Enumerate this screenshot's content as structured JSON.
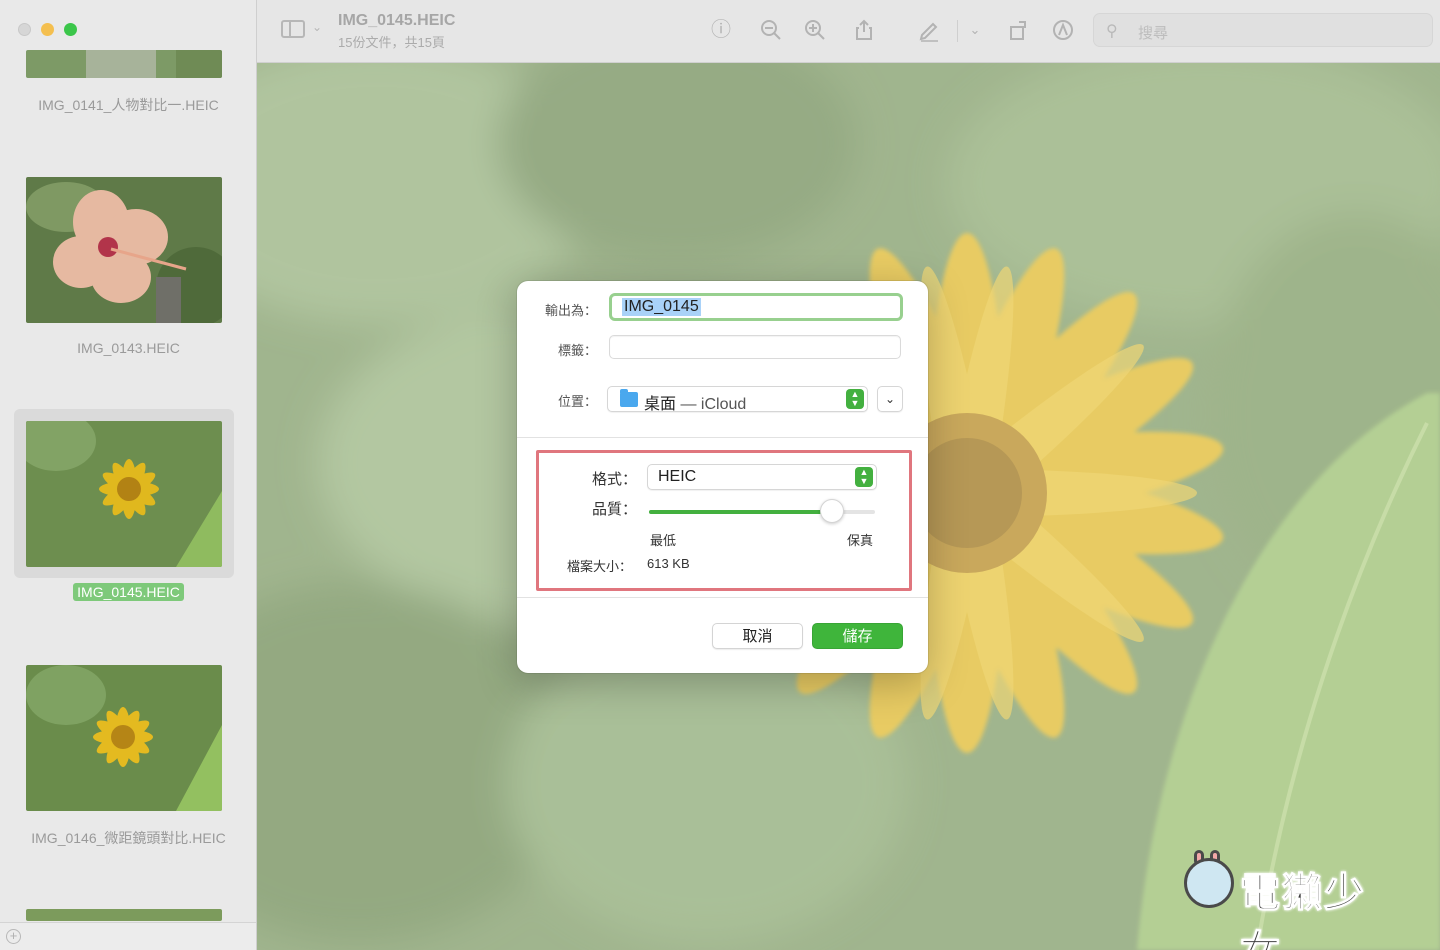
{
  "window": {
    "doc_title": "IMG_0145.HEIC",
    "doc_subtitle": "15份文件，共15頁",
    "search_placeholder": "搜尋"
  },
  "sidebar": {
    "items": [
      {
        "label": "IMG_0141_人物對比一.HEIC"
      },
      {
        "label": "IMG_0143.HEIC"
      },
      {
        "label": "IMG_0145.HEIC",
        "selected": true
      },
      {
        "label": "IMG_0146_微距鏡頭對比.HEIC"
      }
    ]
  },
  "toolbar": {
    "icons": [
      "info-icon",
      "zoom-out-icon",
      "zoom-in-icon",
      "share-icon",
      "markup-icon",
      "markup-menu-icon",
      "rotate-icon",
      "annotate-icon"
    ]
  },
  "dialog": {
    "export_as_label": "輸出為：",
    "export_as_value": "IMG_0145",
    "tags_label": "標籤：",
    "tags_value": "",
    "location_label": "位置：",
    "location_name": "桌面",
    "location_sep": " — ",
    "location_cloud": "iCloud",
    "format_label": "格式：",
    "format_value": "HEIC",
    "quality_label": "品質：",
    "quality_fraction": 0.81,
    "quality_min": "最低",
    "quality_max": "保真",
    "filesize_label": "檔案大小：",
    "filesize_value": "613 KB",
    "cancel_label": "取消",
    "save_label": "儲存"
  },
  "colors": {
    "accent_green": "#43b03f",
    "highlight_red": "#e0767e"
  },
  "watermark": {
    "text": "電獺少女"
  }
}
